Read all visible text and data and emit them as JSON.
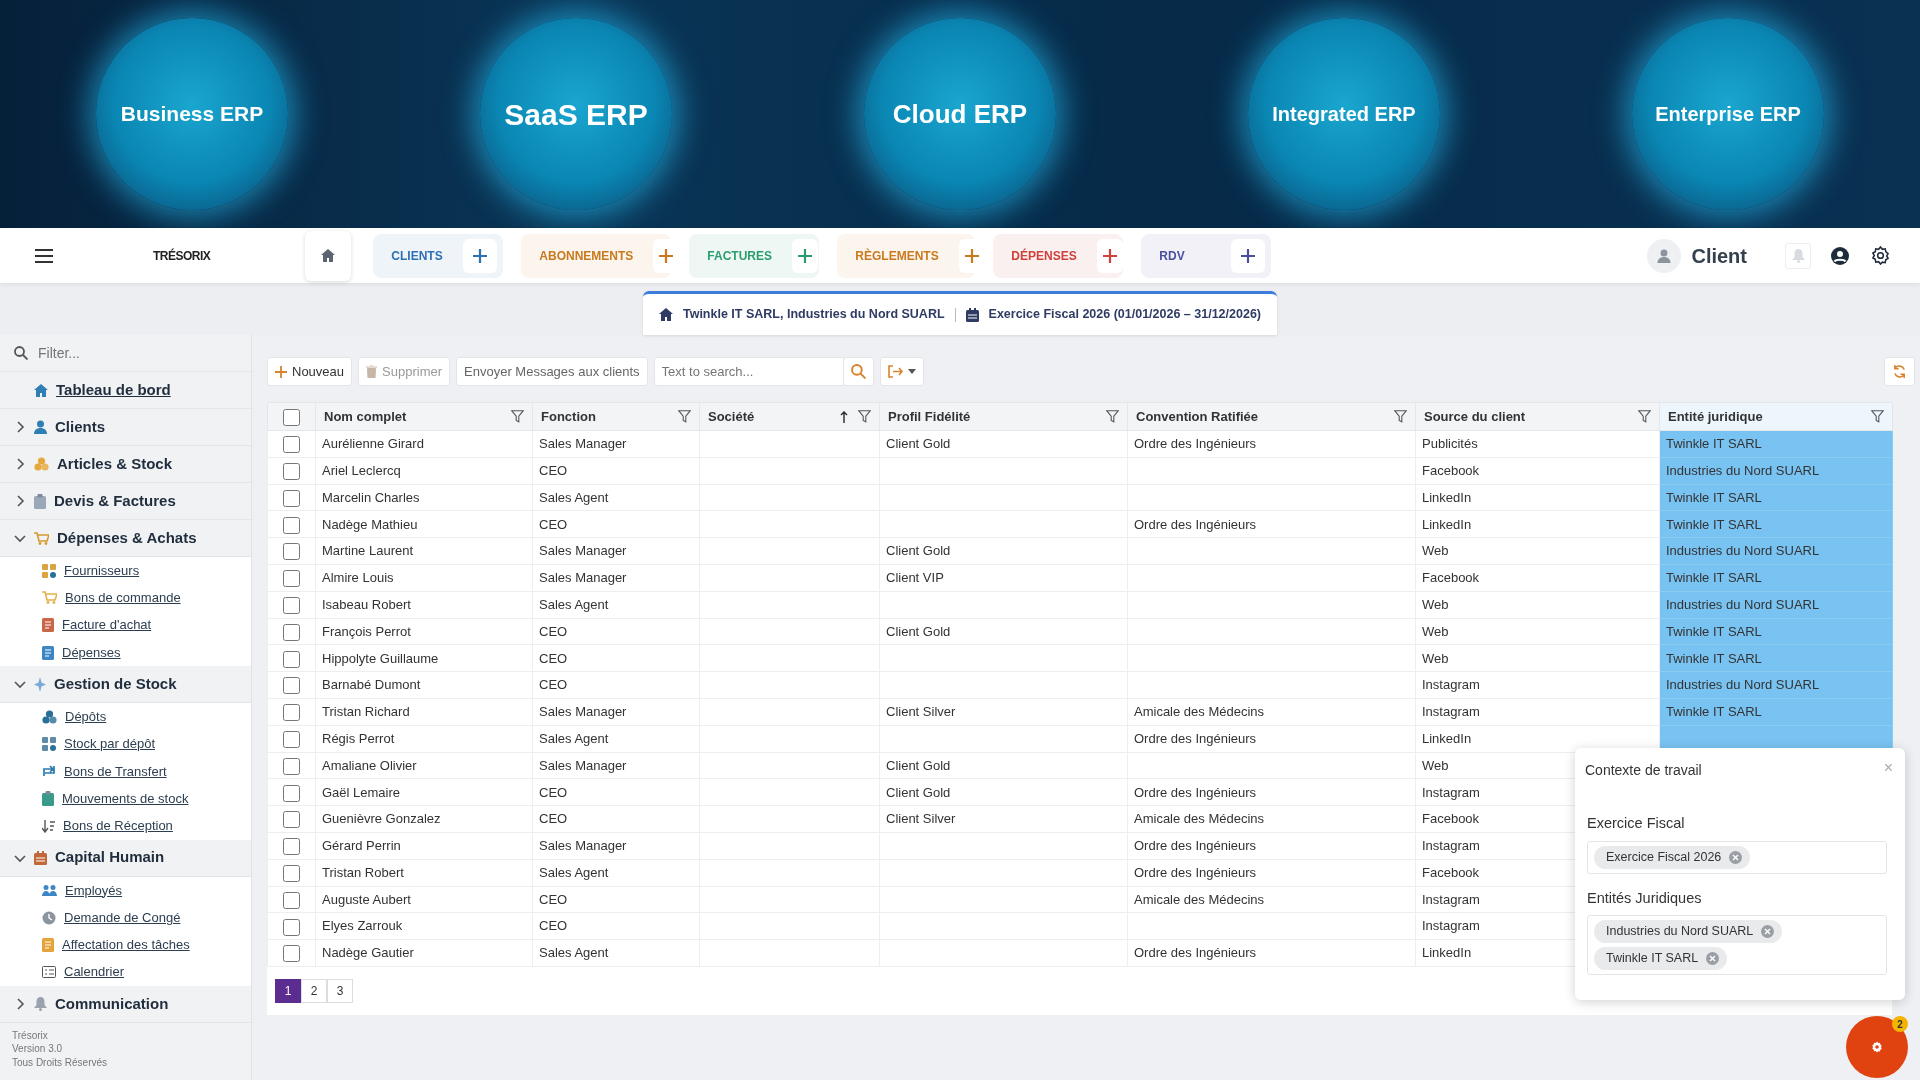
{
  "banner": [
    {
      "label": "Business ERP"
    },
    {
      "label": "SaaS ERP"
    },
    {
      "label": "Cloud ERP"
    },
    {
      "label": "Integrated ERP"
    },
    {
      "label": "Enterprise ERP"
    }
  ],
  "navbar": {
    "logo": "TRÉSORIX",
    "tabs": [
      {
        "label": "CLIENTS",
        "color": "#2f6fb5"
      },
      {
        "label": "ABONNEMENTS",
        "color": "#c97a1e"
      },
      {
        "label": "FACTURES",
        "color": "#2a9d6f"
      },
      {
        "label": "RÈGLEMENTS",
        "color": "#c97a1e"
      },
      {
        "label": "DÉPENSES",
        "color": "#d0413b"
      },
      {
        "label": "RDV",
        "color": "#4a4f9e"
      }
    ],
    "user": "Client"
  },
  "context_bar": {
    "entities": "Twinkle IT SARL, Industries du Nord SUARL",
    "fiscal_year": "Exercice Fiscal 2026 (01/01/2026 – 31/12/2026)"
  },
  "sidebar": {
    "filter_placeholder": "Filter...",
    "items": [
      {
        "label": "Tableau de bord"
      },
      {
        "label": "Clients",
        "expanded": false
      },
      {
        "label": "Articles & Stock",
        "expanded": false
      },
      {
        "label": "Devis & Factures",
        "expanded": false
      },
      {
        "label": "Dépenses & Achats",
        "expanded": true,
        "children": [
          {
            "label": "Fournisseurs"
          },
          {
            "label": "Bons de commande"
          },
          {
            "label": "Facture d'achat"
          },
          {
            "label": "Dépenses"
          }
        ]
      },
      {
        "label": "Gestion de Stock",
        "expanded": true,
        "children": [
          {
            "label": "Dépôts"
          },
          {
            "label": "Stock par dépôt"
          },
          {
            "label": "Bons de Transfert"
          },
          {
            "label": "Mouvements de stock"
          },
          {
            "label": "Bons de Réception"
          }
        ]
      },
      {
        "label": "Capital Humain",
        "expanded": true,
        "children": [
          {
            "label": "Employés"
          },
          {
            "label": "Demande de Congé"
          },
          {
            "label": "Affectation des tâches"
          },
          {
            "label": "Calendrier"
          }
        ]
      },
      {
        "label": "Communication",
        "expanded": false
      }
    ],
    "footer": [
      "Trésorix",
      "Version 3.0",
      "Tous Droits Réservés"
    ]
  },
  "toolbar": {
    "new": "Nouveau",
    "delete": {
      "label": "Supprimer",
      "disabled": true
    },
    "send": "Envoyer Messages aux clients",
    "search_placeholder": "Text to search..."
  },
  "table": {
    "select_all_checked": false,
    "columns": [
      {
        "label": "Nom complet",
        "selected": false
      },
      {
        "label": "Fonction",
        "selected": false
      },
      {
        "label": "Société",
        "selected": false,
        "sort_ascending": true
      },
      {
        "label": "Profil Fidélité",
        "selected": false
      },
      {
        "label": "Convention Ratifiée",
        "selected": false
      },
      {
        "label": "Source du client",
        "selected": false
      },
      {
        "label": "Entité juridique",
        "selected": true
      }
    ],
    "rows": [
      {
        "checked": false,
        "nom_complet": "Aurélienne Girard",
        "fonction": "Sales Manager",
        "profil_fidelite": "Client Gold",
        "convention_ratifiee": "Ordre des Ingénieurs",
        "source_du_client": "Publicités",
        "entite_juridique": "Twinkle IT SARL"
      },
      {
        "checked": false,
        "nom_complet": "Ariel Leclercq",
        "fonction": "CEO",
        "source_du_client": "Facebook",
        "entite_juridique": "Industries du Nord SUARL"
      },
      {
        "checked": false,
        "nom_complet": "Marcelin Charles",
        "fonction": "Sales Agent",
        "source_du_client": "LinkedIn",
        "entite_juridique": "Twinkle IT SARL"
      },
      {
        "checked": false,
        "nom_complet": "Nadège Mathieu",
        "fonction": "CEO",
        "convention_ratifiee": "Ordre des Ingénieurs",
        "source_du_client": "LinkedIn",
        "entite_juridique": "Twinkle IT SARL"
      },
      {
        "checked": false,
        "nom_complet": "Martine Laurent",
        "fonction": "Sales Manager",
        "profil_fidelite": "Client Gold",
        "source_du_client": "Web",
        "entite_juridique": "Industries du Nord SUARL"
      },
      {
        "checked": false,
        "nom_complet": "Almire Louis",
        "fonction": "Sales Manager",
        "profil_fidelite": "Client VIP",
        "source_du_client": "Facebook",
        "entite_juridique": "Twinkle IT SARL"
      },
      {
        "checked": false,
        "nom_complet": "Isabeau Robert",
        "fonction": "Sales Agent",
        "source_du_client": "Web",
        "entite_juridique": "Industries du Nord SUARL"
      },
      {
        "checked": false,
        "nom_complet": "François Perrot",
        "fonction": "CEO",
        "profil_fidelite": "Client Gold",
        "source_du_client": "Web",
        "entite_juridique": "Twinkle IT SARL"
      },
      {
        "checked": false,
        "nom_complet": "Hippolyte Guillaume",
        "fonction": "CEO",
        "source_du_client": "Web",
        "entite_juridique": "Twinkle IT SARL"
      },
      {
        "checked": false,
        "nom_complet": "Barnabé Dumont",
        "fonction": "CEO",
        "source_du_client": "Instagram",
        "entite_juridique": "Industries du Nord SUARL"
      },
      {
        "checked": false,
        "nom_complet": "Tristan Richard",
        "fonction": "Sales Manager",
        "profil_fidelite": "Client Silver",
        "convention_ratifiee": "Amicale des Médecins",
        "source_du_client": "Instagram",
        "entite_juridique": "Twinkle IT SARL"
      },
      {
        "checked": false,
        "nom_complet": "Régis Perrot",
        "fonction": "Sales Agent",
        "convention_ratifiee": "Ordre des Ingénieurs",
        "source_du_client": "LinkedIn"
      },
      {
        "checked": false,
        "nom_complet": "Amaliane Olivier",
        "fonction": "Sales Manager",
        "profil_fidelite": "Client Gold",
        "source_du_client": "Web"
      },
      {
        "checked": false,
        "nom_complet": "Gaël Lemaire",
        "fonction": "CEO",
        "profil_fidelite": "Client Gold",
        "convention_ratifiee": "Ordre des Ingénieurs",
        "source_du_client": "Instagram"
      },
      {
        "checked": false,
        "nom_complet": "Guenièvre Gonzalez",
        "fonction": "CEO",
        "profil_fidelite": "Client Silver",
        "convention_ratifiee": "Amicale des Médecins",
        "source_du_client": "Facebook"
      },
      {
        "checked": false,
        "nom_complet": "Gérard Perrin",
        "fonction": "Sales Manager",
        "convention_ratifiee": "Ordre des Ingénieurs",
        "source_du_client": "Instagram"
      },
      {
        "checked": false,
        "nom_complet": "Tristan Robert",
        "fonction": "Sales Agent",
        "convention_ratifiee": "Ordre des Ingénieurs",
        "source_du_client": "Facebook"
      },
      {
        "checked": false,
        "nom_complet": "Auguste Aubert",
        "fonction": "CEO",
        "convention_ratifiee": "Amicale des Médecins",
        "source_du_client": "Instagram"
      },
      {
        "checked": false,
        "nom_complet": "Elyes Zarrouk",
        "fonction": "CEO",
        "source_du_client": "Instagram"
      },
      {
        "checked": false,
        "nom_complet": "Nadège Gautier",
        "fonction": "Sales Agent",
        "convention_ratifiee": "Ordre des Ingénieurs",
        "source_du_client": "LinkedIn"
      }
    ],
    "pages": [
      {
        "label": "1",
        "selected": true
      },
      {
        "label": "2",
        "selected": false
      },
      {
        "label": "3",
        "selected": false
      }
    ]
  },
  "context_panel": {
    "title": "Contexte de travail",
    "close": "×",
    "sections": [
      {
        "label": "Exercice Fiscal",
        "chips": [
          "Exercice Fiscal 2026"
        ]
      },
      {
        "label": "Entités Juridiques",
        "chips": [
          "Industries du Nord SUARL",
          "Twinkle IT SARL"
        ]
      }
    ]
  },
  "fab": {
    "badge": "2"
  }
}
